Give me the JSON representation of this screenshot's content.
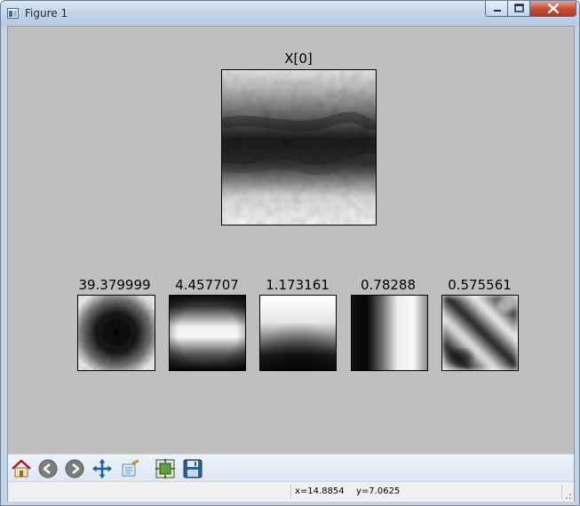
{
  "window": {
    "title": "Figure 1"
  },
  "figure": {
    "main_image": {
      "title": "X[0]"
    },
    "components": [
      {
        "title": "39.379999",
        "icon": "dark-blob"
      },
      {
        "title": "4.457707",
        "icon": "horizontal-bright-band"
      },
      {
        "title": "1.173161",
        "icon": "top-bright-gradient"
      },
      {
        "title": "0.78288",
        "icon": "left-dark-band"
      },
      {
        "title": "0.575561",
        "icon": "diagonal-stripes"
      }
    ]
  },
  "toolbar": {
    "tools": [
      {
        "name": "home-icon"
      },
      {
        "name": "back-arrow-icon"
      },
      {
        "name": "forward-arrow-icon"
      },
      {
        "name": "pan-icon"
      },
      {
        "name": "zoom-rect-icon"
      },
      {
        "name": "subplots-config-icon"
      },
      {
        "name": "save-floppy-icon"
      }
    ]
  },
  "status": {
    "x_readout": "x=14.8854",
    "y_readout": "y=7.0625"
  },
  "colors": {
    "figure_background": "#bfbfbf",
    "title_bar": "#c2d3e8",
    "close_button": "#c84a35"
  }
}
